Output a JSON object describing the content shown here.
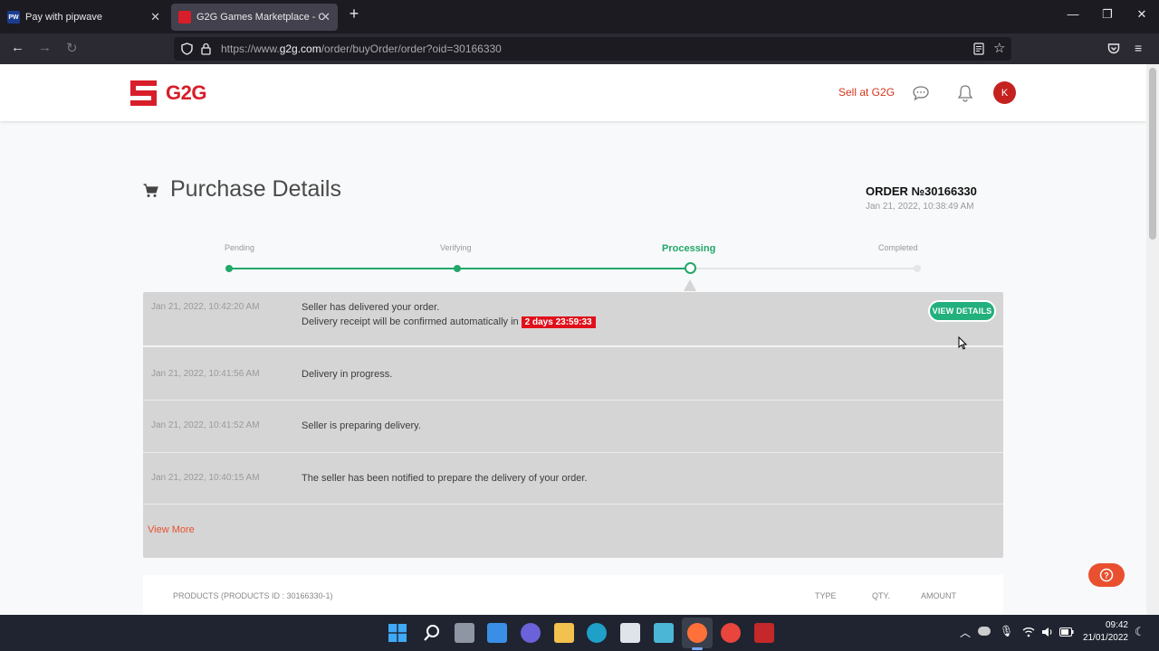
{
  "browser": {
    "tabs": [
      {
        "label": "Pay with pipwave",
        "favicon": "PW",
        "active": false
      },
      {
        "label": "G2G Games Marketplace - Ord",
        "favicon": "G2G",
        "active": true
      }
    ],
    "new_tab": "+",
    "url_prefix": "https://www.",
    "url_domain": "g2g.com",
    "url_path": "/order/buyOrder/order?oid=30166330"
  },
  "header": {
    "logo_text": "G2G",
    "sell_label": "Sell at G2G",
    "avatar_initial": "K",
    "brand_color": "#d81e2a"
  },
  "page": {
    "title": "Purchase Details",
    "order_number": "ORDER №30166330",
    "order_date": "Jan 21, 2022, 10:38:49 AM"
  },
  "progress": {
    "steps": [
      "Pending",
      "Verifying",
      "Processing",
      "Completed"
    ],
    "current": "Processing",
    "accent": "#22a76a"
  },
  "events": [
    {
      "time": "Jan 21, 2022, 10:42:20 AM",
      "line1": "Seller has delivered your order.",
      "line2": "Delivery receipt will be confirmed automatically in",
      "timer": "2 days 23:59:33",
      "action": "VIEW DETAILS"
    },
    {
      "time": "Jan 21, 2022, 10:41:56 AM",
      "line1": "Delivery in progress."
    },
    {
      "time": "Jan 21, 2022, 10:41:52 AM",
      "line1": "Seller is preparing delivery."
    },
    {
      "time": "Jan 21, 2022, 10:40:15 AM",
      "line1": "The seller has been notified to prepare the delivery of your order."
    }
  ],
  "view_more": "View More",
  "products": {
    "header": "PRODUCTS (PRODUCTS ID : 30166330-1)",
    "col_type": "TYPE",
    "col_qty": "QTY.",
    "col_amount": "AMOUNT"
  },
  "taskbar": {
    "time": "09:42",
    "date": "21/01/2022"
  }
}
